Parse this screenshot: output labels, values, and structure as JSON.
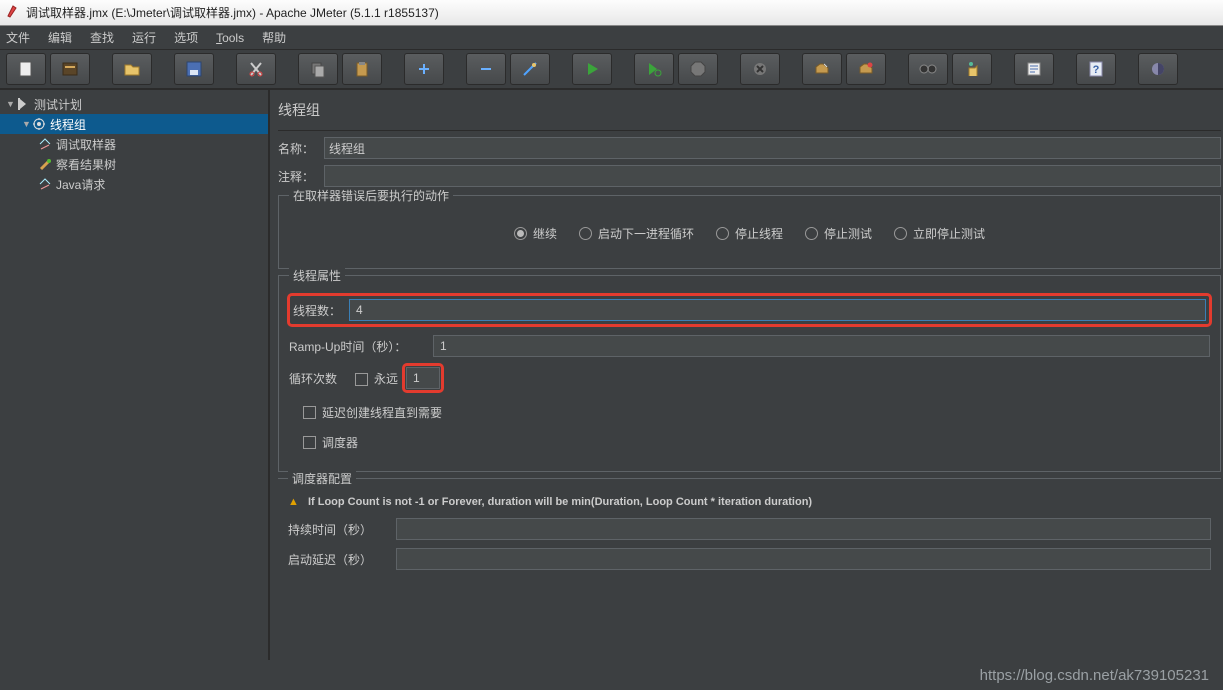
{
  "title": "调试取样器.jmx (E:\\Jmeter\\调试取样器.jmx) - Apache JMeter (5.1.1 r1855137)",
  "menus": [
    "文件",
    "编辑",
    "查找",
    "运行",
    "选项",
    "Tools",
    "帮助"
  ],
  "tree": {
    "root": "测试计划",
    "items": [
      "线程组",
      "调试取样器",
      "察看结果树",
      "Java请求"
    ]
  },
  "panel": {
    "heading": "线程组",
    "name_label": "名称：",
    "name_value": "线程组",
    "comment_label": "注释：",
    "comment_value": "",
    "error_action": {
      "legend": "在取样器错误后要执行的动作",
      "options": [
        "继续",
        "启动下一进程循环",
        "停止线程",
        "停止测试",
        "立即停止测试"
      ],
      "selected": 0
    },
    "thread_props": {
      "legend": "线程属性",
      "threads_label": "线程数：",
      "threads_value": "4",
      "ramp_label": "Ramp-Up时间（秒）：",
      "ramp_value": "1",
      "loop_label": "循环次数",
      "forever_label": "永远",
      "loop_value": "1",
      "delay_create": "延迟创建线程直到需要",
      "scheduler": "调度器"
    },
    "scheduler": {
      "legend": "调度器配置",
      "warning": "If Loop Count is not -1 or Forever, duration will be min(Duration, Loop Count * iteration duration)",
      "duration_label": "持续时间（秒）",
      "duration_value": "",
      "delay_label": "启动延迟（秒）",
      "delay_value": ""
    }
  },
  "watermark": "https://blog.csdn.net/ak739105231"
}
